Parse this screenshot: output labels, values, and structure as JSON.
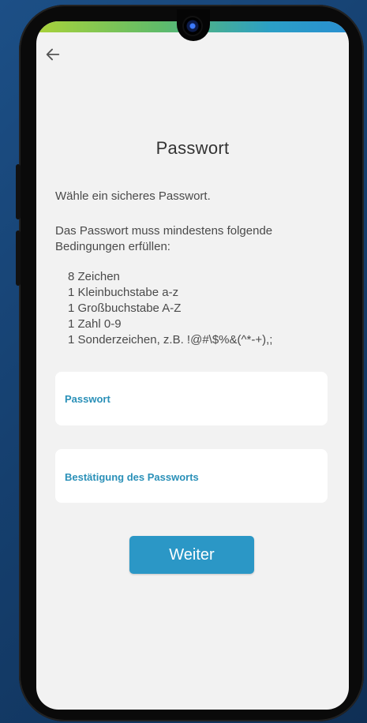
{
  "colors": {
    "accent": "#2b97c6",
    "label": "#2a90b8",
    "screen_bg": "#f2f2f2"
  },
  "nav": {
    "back_icon": "arrow-left-icon"
  },
  "page": {
    "title": "Passwort",
    "intro": "Wähle ein sicheres Passwort.",
    "requirements_intro_line1": "Das Passwort muss mindestens folgende",
    "requirements_intro_line2": "Bedingungen erfüllen:",
    "requirements": [
      "8 Zeichen",
      "1 Kleinbuchstabe a-z",
      "1 Großbuchstabe A-Z",
      "1 Zahl 0-9",
      "1 Sonderzeichen, z.B. !@#\\$%&(^*-+),;"
    ]
  },
  "form": {
    "password_label": "Passwort",
    "password_value": "",
    "confirm_label": "Bestätigung des Passworts",
    "confirm_value": ""
  },
  "actions": {
    "continue_label": "Weiter"
  }
}
